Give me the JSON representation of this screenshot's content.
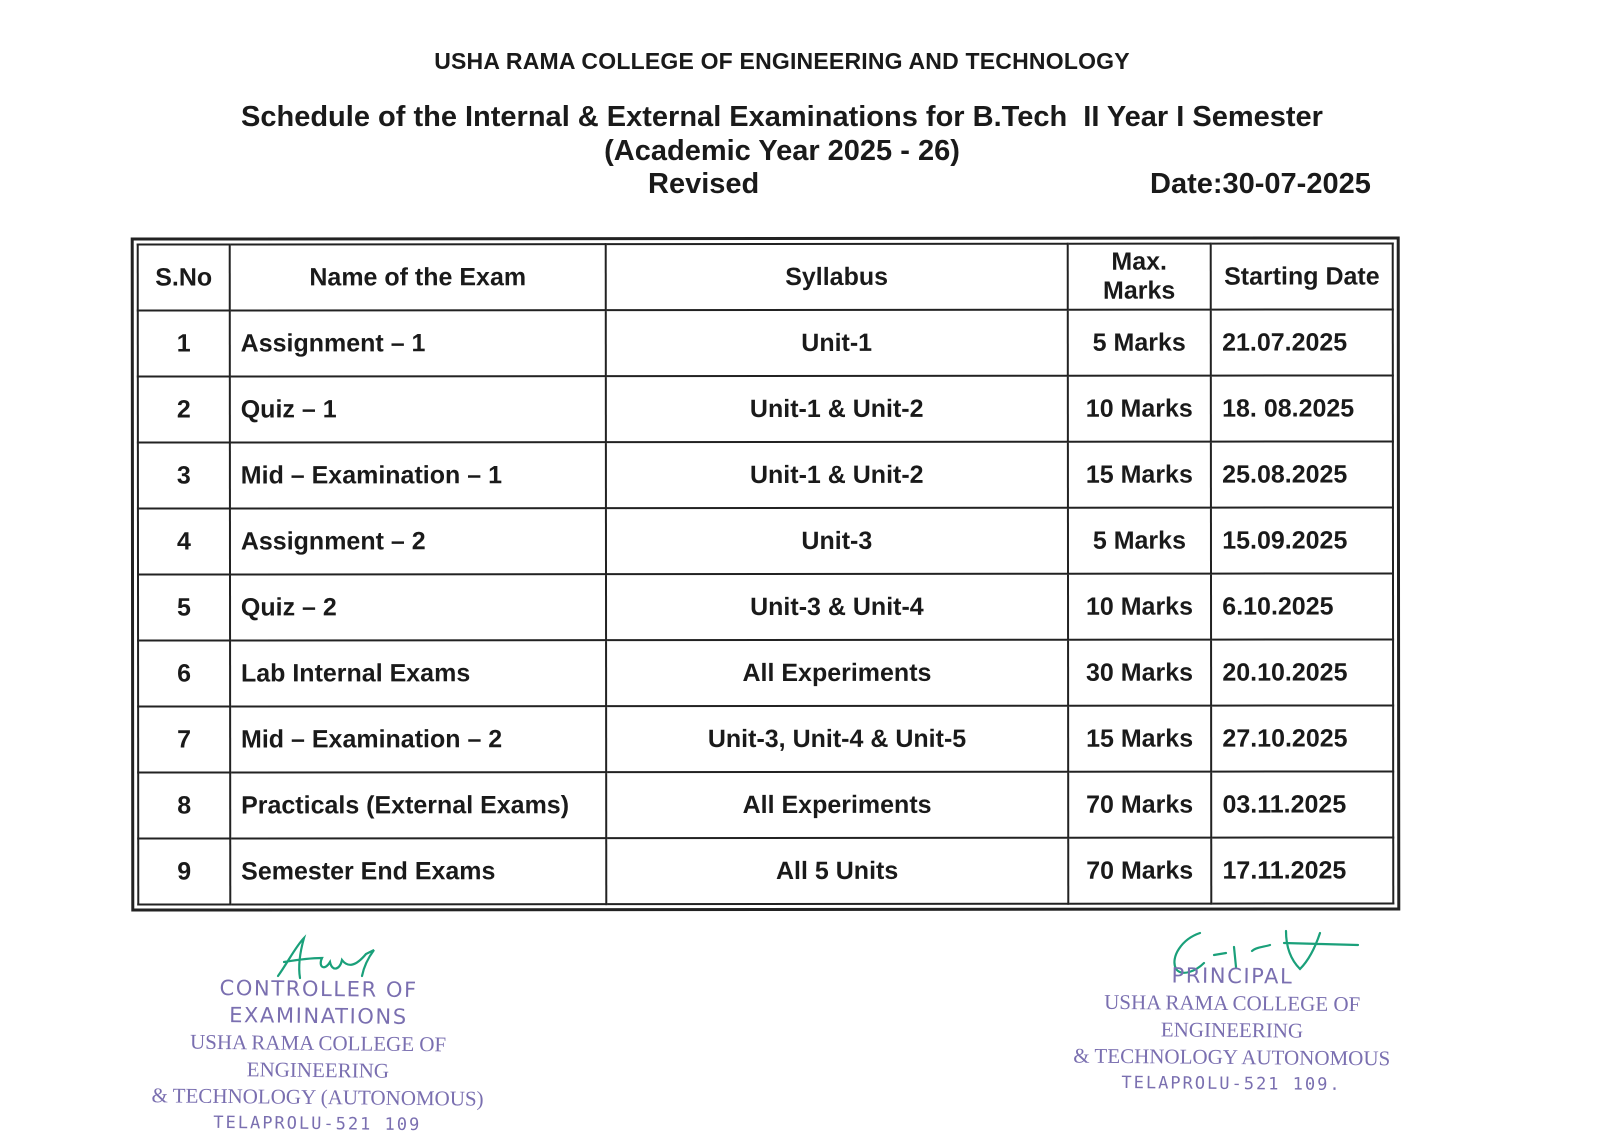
{
  "header": {
    "college": "USHA RAMA COLLEGE OF ENGINEERING AND TECHNOLOGY",
    "subtitle_line1": "Schedule of the Internal & External Examinations for B.Tech  II Year I Semester",
    "subtitle_line2": "(Academic Year 2025 - 26)",
    "revised": "Revised",
    "date": "Date:30-07-2025"
  },
  "table": {
    "columns": [
      "S.No",
      "Name of the Exam",
      "Syllabus",
      "Max. Marks",
      "Starting Date"
    ],
    "rows": [
      [
        "1",
        "Assignment – 1",
        "Unit-1",
        "5 Marks",
        "21.07.2025"
      ],
      [
        "2",
        "Quiz – 1",
        "Unit-1 & Unit-2",
        "10 Marks",
        "18. 08.2025"
      ],
      [
        "3",
        "Mid – Examination – 1",
        "Unit-1 & Unit-2",
        "15 Marks",
        "25.08.2025"
      ],
      [
        "4",
        "Assignment – 2",
        "Unit-3",
        "5 Marks",
        "15.09.2025"
      ],
      [
        "5",
        "Quiz – 2",
        "Unit-3 & Unit-4",
        "10 Marks",
        "6.10.2025"
      ],
      [
        "6",
        "Lab Internal Exams",
        "All Experiments",
        "30 Marks",
        "20.10.2025"
      ],
      [
        "7",
        "Mid – Examination – 2",
        "Unit-3, Unit-4 & Unit-5",
        "15 Marks",
        "27.10.2025"
      ],
      [
        "8",
        "Practicals (External Exams)",
        "All Experiments",
        "70 Marks",
        "03.11.2025"
      ],
      [
        "9",
        "Semester End Exams",
        "All 5 Units",
        "70 Marks",
        "17.11.2025"
      ]
    ]
  },
  "stamps": {
    "left": {
      "lines": [
        "CONTROLLER OF EXAMINATIONS",
        "USHA RAMA COLLEGE OF ENGINEERING",
        "& TECHNOLOGY (AUTONOMOUS)",
        "TELAPROLU-521 109"
      ]
    },
    "right": {
      "lines": [
        "PRINCIPAL",
        "USHA RAMA COLLEGE OF ENGINEERING",
        "& TECHNOLOGY AUTONOMOUS",
        "TELAPROLU-521 109."
      ]
    }
  },
  "colors": {
    "text": "#1a1a1a",
    "stamp_ink": "#7a6fb0",
    "signature_ink": "#1aa07a"
  }
}
